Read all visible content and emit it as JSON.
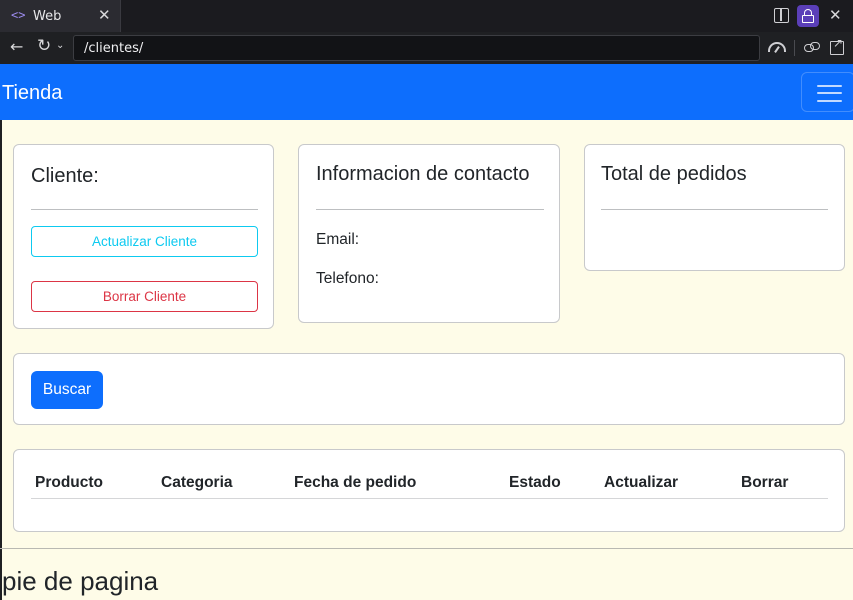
{
  "browser": {
    "tab_code_icon": "<>",
    "tab_title": "Web",
    "tab_close": "✕",
    "window_close": "✕",
    "back_icon": "←",
    "reload_icon": "↻",
    "dropdown_icon": "⌄",
    "url": "/clientes/"
  },
  "navbar": {
    "brand": "Tienda"
  },
  "cliente_card": {
    "title": "Cliente:",
    "update_button": "Actualizar Cliente",
    "delete_button": "Borrar Cliente"
  },
  "contact_card": {
    "title": "Informacion de contacto",
    "email_label": "Email:",
    "phone_label": "Telefono:"
  },
  "orders_card": {
    "title": "Total de pedidos"
  },
  "search": {
    "button": "Buscar"
  },
  "orders_table": {
    "headers": [
      "Producto",
      "Categoria",
      "Fecha de pedido",
      "Estado",
      "Actualizar",
      "Borrar"
    ]
  },
  "footer": {
    "text": "pie de pagina"
  },
  "colors": {
    "primary": "#0d6efd",
    "info": "#0dcaf0",
    "danger": "#dc3545",
    "page_background": "#fefce8"
  }
}
